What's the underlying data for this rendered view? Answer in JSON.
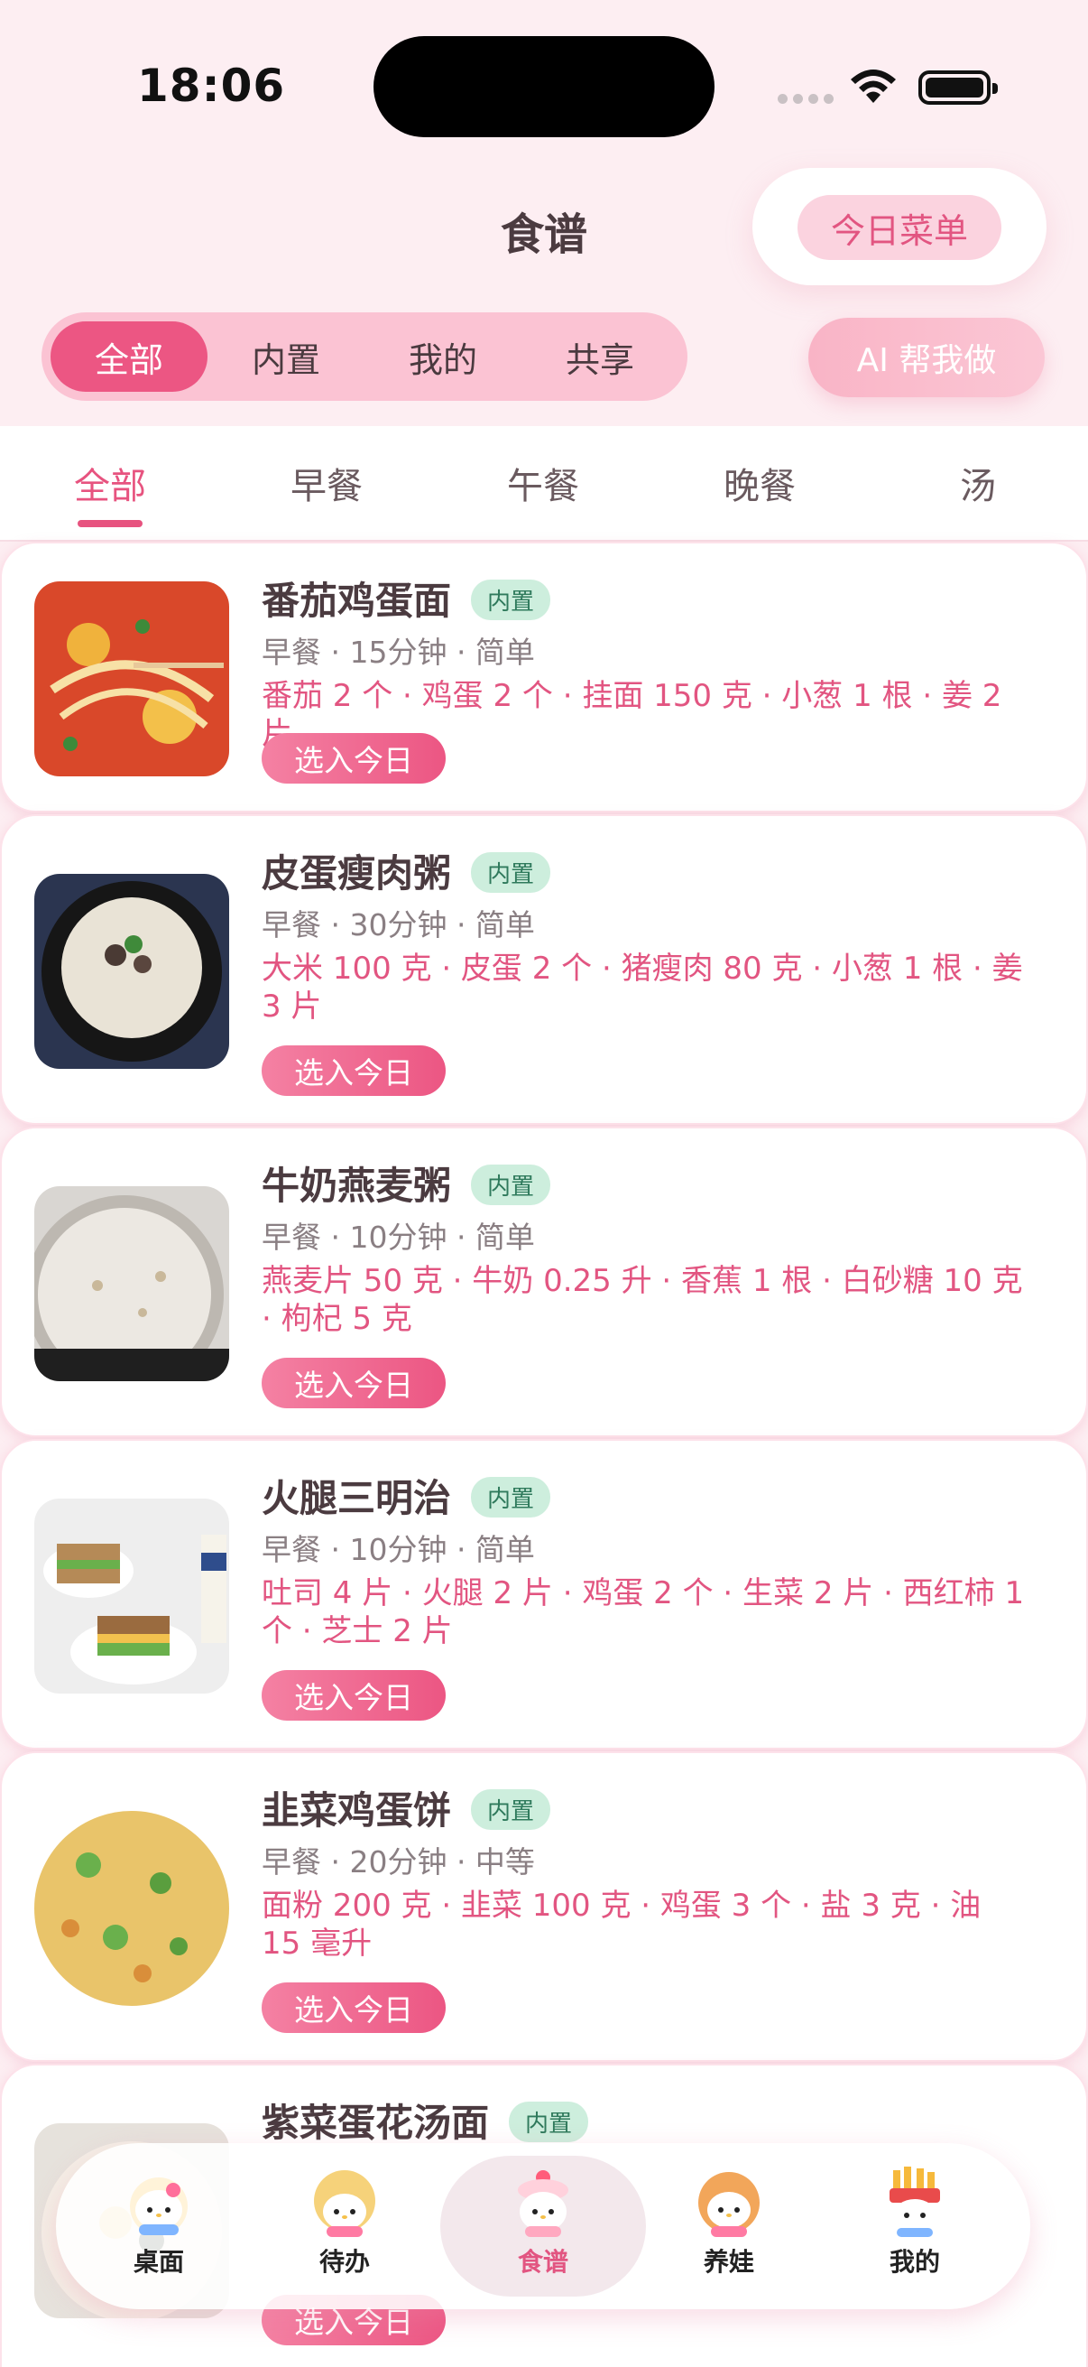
{
  "status": {
    "time": "18:06"
  },
  "header": {
    "title": "食谱",
    "today_menu": "今日菜单",
    "ai_button": "AI 帮我做",
    "source_tabs": [
      "全部",
      "内置",
      "我的",
      "共享"
    ]
  },
  "categories": [
    "全部",
    "早餐",
    "午餐",
    "晚餐",
    "汤"
  ],
  "recipes": [
    {
      "name": "番茄鸡蛋面",
      "tag": "内置",
      "meta": "早餐 · 15分钟 · 简单",
      "ingredients": "番茄 2 个 · 鸡蛋 2 个 · 挂面 150 克 · 小葱 1 根 · 姜 2 片",
      "action": "选入今日"
    },
    {
      "name": "皮蛋瘦肉粥",
      "tag": "内置",
      "meta": "早餐 · 30分钟 · 简单",
      "ingredients": "大米 100 克 · 皮蛋 2 个 · 猪瘦肉 80 克 · 小葱 1 根 · 姜 3 片",
      "action": "选入今日"
    },
    {
      "name": "牛奶燕麦粥",
      "tag": "内置",
      "meta": "早餐 · 10分钟 · 简单",
      "ingredients": "燕麦片 50 克 · 牛奶 0.25 升 · 香蕉 1 根 · 白砂糖 10 克 · 枸杞 5 克",
      "action": "选入今日"
    },
    {
      "name": "火腿三明治",
      "tag": "内置",
      "meta": "早餐 · 10分钟 · 简单",
      "ingredients": "吐司 4 片 · 火腿 2 片 · 鸡蛋 2 个 · 生菜 2 片 · 西红柿 1 个 · 芝士 2 片",
      "action": "选入今日"
    },
    {
      "name": "韭菜鸡蛋饼",
      "tag": "内置",
      "meta": "早餐 · 20分钟 · 中等",
      "ingredients": "面粉 200 克 · 韭菜 100 克 · 鸡蛋 3 个 · 盐 3 克 · 油 15 毫升",
      "action": "选入今日"
    },
    {
      "name": "紫菜蛋花汤面",
      "tag": "内置",
      "meta": "",
      "ingredients": "",
      "action": "选入今日"
    }
  ],
  "tabbar": [
    {
      "label": "桌面",
      "icon": "kitty-desk-icon"
    },
    {
      "label": "待办",
      "icon": "kitty-todo-icon"
    },
    {
      "label": "食谱",
      "icon": "kitty-recipe-icon"
    },
    {
      "label": "养娃",
      "icon": "kitty-baby-icon"
    },
    {
      "label": "我的",
      "icon": "kitty-me-icon"
    }
  ],
  "colors": {
    "accent": "#ec5683",
    "tag_bg": "#cdeedd",
    "tag_text": "#2f7a5c",
    "ingredient": "#e25581"
  }
}
